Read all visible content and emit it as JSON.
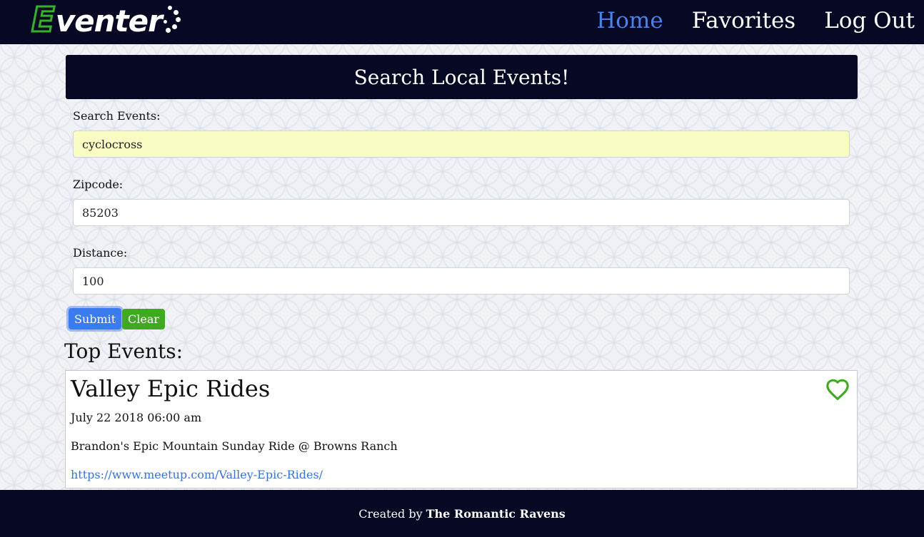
{
  "brand": {
    "logo_first_letter": "E",
    "logo_rest": "venter",
    "logo_icon": "dots-icon"
  },
  "nav": {
    "items": [
      {
        "label": "Home",
        "active": true
      },
      {
        "label": "Favorites",
        "active": false
      },
      {
        "label": "Log Out",
        "active": false
      }
    ]
  },
  "search": {
    "title": "Search Local Events!",
    "fields": {
      "search": {
        "label": "Search Events:",
        "value": "cyclocross"
      },
      "zipcode": {
        "label": "Zipcode:",
        "value": "85203"
      },
      "distance": {
        "label": "Distance:",
        "value": "100"
      }
    },
    "submit_label": "Submit",
    "clear_label": "Clear"
  },
  "results": {
    "title": "Top Events:",
    "events": [
      {
        "name": "Valley Epic Rides",
        "date": "July 22 2018 06:00 am",
        "description": "Brandon's Epic Mountain Sunday Ride @ Browns Ranch",
        "url": "https://www.meetup.com/Valley-Epic-Rides/",
        "favorite_icon": "heart-outline-icon"
      }
    ]
  },
  "footer": {
    "prefix": "Created by",
    "team": "The Romantic Ravens"
  },
  "colors": {
    "nav_bg": "#070823",
    "accent": "#4c82ea",
    "submit": "#3a7bf0",
    "clear": "#3eaa20",
    "link": "#3a73d6"
  }
}
